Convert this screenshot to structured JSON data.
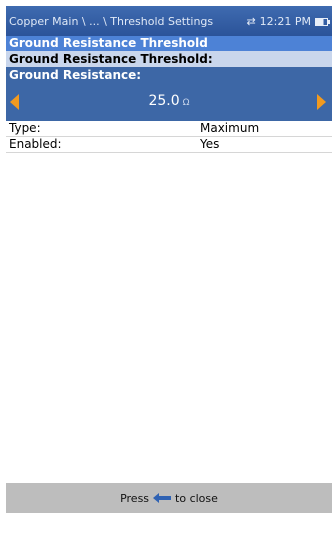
{
  "titlebar": {
    "path": "Copper Main \\ ... \\ Threshold Settings",
    "time": "12:21 PM",
    "icons": [
      "network-icon",
      "battery-icon"
    ]
  },
  "header": {
    "title": "Ground Resistance Threshold",
    "subtitle": "Ground Resistance Threshold:"
  },
  "editor": {
    "label": "Ground Resistance:",
    "value": "25.0",
    "unit": "Ω"
  },
  "properties": [
    {
      "key": "Type:",
      "value": "Maximum"
    },
    {
      "key": "Enabled:",
      "value": "Yes"
    }
  ],
  "footer": {
    "prefix": "Press",
    "suffix": "to close"
  },
  "colors": {
    "titlebar": "#2b5399",
    "selected_row": "#4d82d6",
    "sub_row": "#c9d6ec",
    "editor": "#3d67a6",
    "arrow": "#f29a1f",
    "footer": "#bdbdbd"
  }
}
